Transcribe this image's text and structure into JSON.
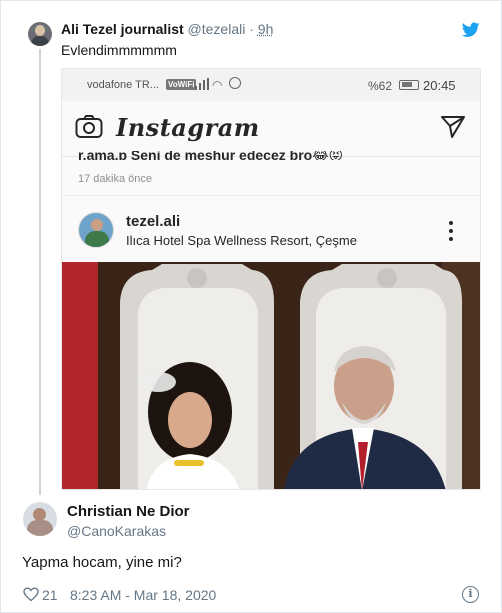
{
  "quoted_tweet": {
    "name": "Ali Tezel journalist",
    "handle": "@tezelali",
    "separator": "·",
    "time": "9h",
    "text": "Evlendimmmmmm"
  },
  "embedded_screenshot": {
    "status_bar": {
      "carrier": "vodafone TR...",
      "wifi_badge": "VoWiFi",
      "battery_pct": "%62",
      "clock": "20:45"
    },
    "app": {
      "logo": "Instagram",
      "icons": [
        "camera-icon",
        "send-icon"
      ]
    },
    "comment_partial": "r.ama.p Seni de meshur edecez bro😂😝",
    "comment_time": "17 dakika önce",
    "post": {
      "username": "tezel.ali",
      "location": "Ilıca Hotel Spa Wellness Resort, Çeşme"
    }
  },
  "reply": {
    "name": "Christian Ne Dior",
    "handle": "@CanoKarakas",
    "text": "Yapma hocam, yine mi?",
    "likes": "21",
    "timestamp": "8:23 AM - Mar 18, 2020"
  },
  "colors": {
    "twitter_blue": "#1da1f2",
    "secondary_text": "#657786",
    "thread_line": "#ccd6dd"
  }
}
